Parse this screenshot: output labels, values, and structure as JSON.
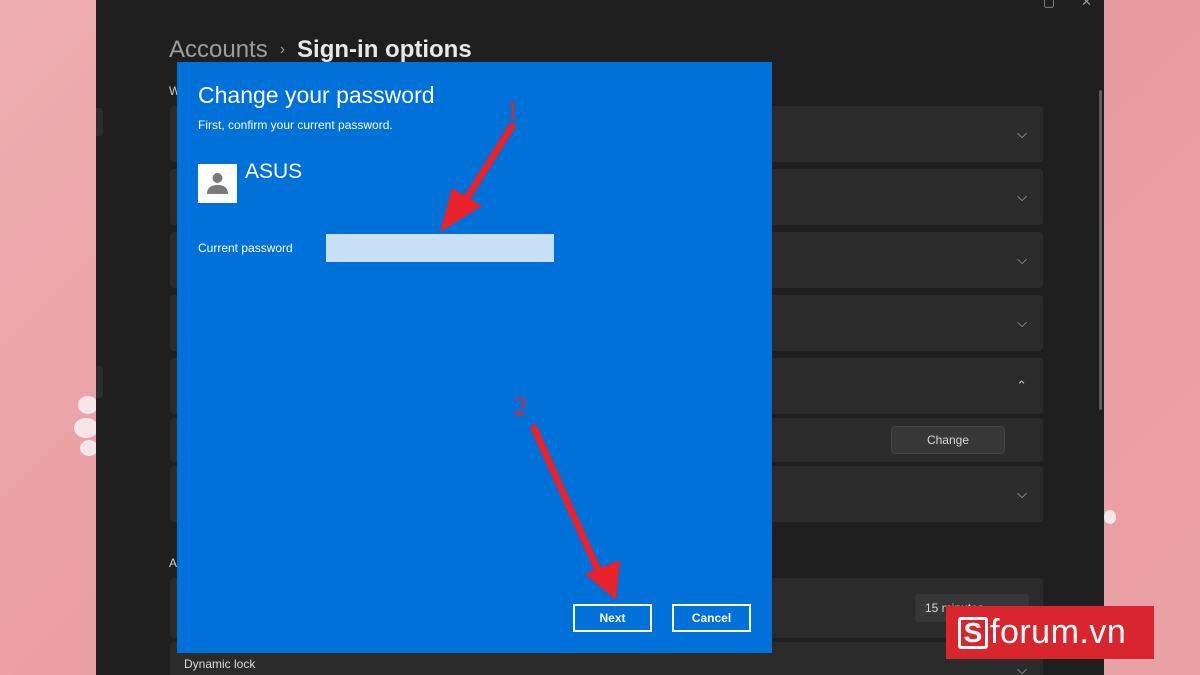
{
  "settings": {
    "breadcrumb": {
      "parent": "Accounts",
      "separator": "›",
      "current": "Sign-in options"
    },
    "section_headers": [
      "W",
      "A"
    ],
    "change_button_label": "Change",
    "lock_select_value": "15 minutes",
    "dynamic_lock_label": "Dynamic lock",
    "window_controls": [
      "▢",
      "✕"
    ]
  },
  "dialog": {
    "title": "Change your password",
    "subtitle": "First, confirm your current password.",
    "user_name": "ASUS",
    "password_label": "Current password",
    "password_value": "",
    "next_label": "Next",
    "cancel_label": "Cancel"
  },
  "annotations": {
    "step1": "1",
    "step2": "2"
  },
  "watermark": {
    "mark": "S",
    "text": "forum.vn"
  },
  "colors": {
    "dialog_bg": "#0071D8",
    "settings_bg": "#1F1F1F",
    "card_bg": "#2B2B2B",
    "annotation_red": "#E8222A",
    "logo_red": "#D9262E",
    "page_bg": "#EBA4A8"
  }
}
